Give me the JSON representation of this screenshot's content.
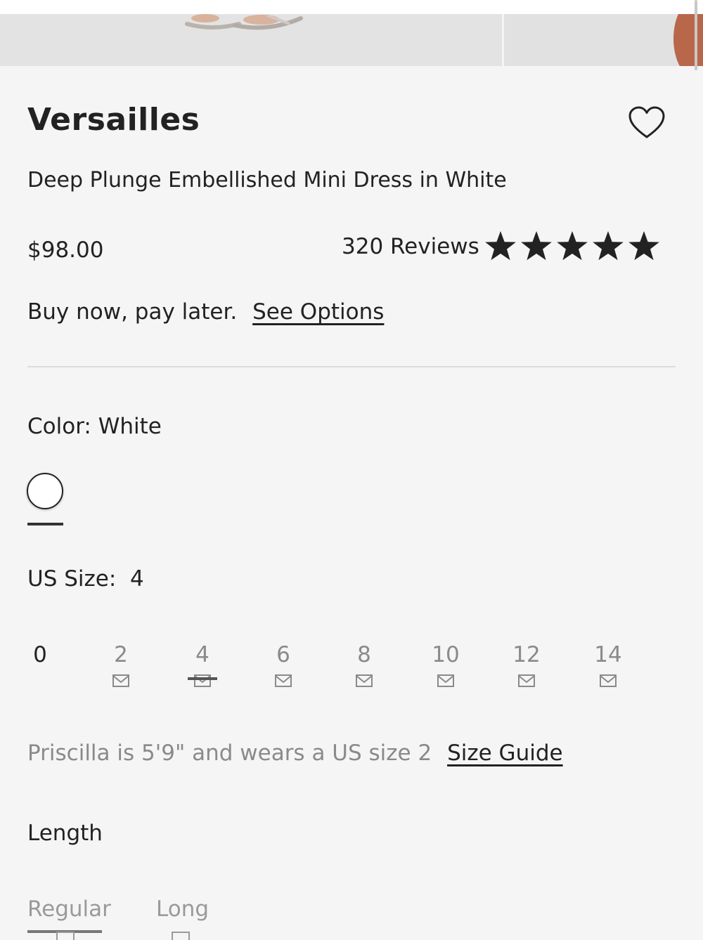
{
  "product": {
    "brand": "Versailles",
    "name": "Deep Plunge Embellished Mini Dress in White",
    "price": "$98.00",
    "reviews_label": "320 Reviews",
    "rating": 5,
    "wishlist_icon": "heart-outline-icon"
  },
  "payment": {
    "text": "Buy now, pay later.",
    "link": "See Options"
  },
  "color": {
    "label": "Color: White",
    "selected_swatch": "#ffffff"
  },
  "size": {
    "label": "US Size:  4",
    "options": [
      {
        "label": "0",
        "available": true,
        "notify_icon": false
      },
      {
        "label": "2",
        "available": false,
        "notify_icon": true
      },
      {
        "label": "4",
        "available": false,
        "notify_icon": true,
        "selected": true
      },
      {
        "label": "6",
        "available": false,
        "notify_icon": true
      },
      {
        "label": "8",
        "available": false,
        "notify_icon": true
      },
      {
        "label": "10",
        "available": false,
        "notify_icon": true
      },
      {
        "label": "12",
        "available": false,
        "notify_icon": true
      },
      {
        "label": "14",
        "available": false,
        "notify_icon": true
      }
    ],
    "notify_icon_name": "mail-icon"
  },
  "fit_note": {
    "text": "Priscilla is 5'9\" and wears a US size 2",
    "link": "Size Guide"
  },
  "length": {
    "label": "Length",
    "options": [
      {
        "label": "Regular",
        "selected": true
      },
      {
        "label": "Long",
        "selected": false
      }
    ]
  },
  "colors": {
    "background": "#f5f5f5",
    "text": "#222222",
    "muted": "#8a8a8a"
  }
}
